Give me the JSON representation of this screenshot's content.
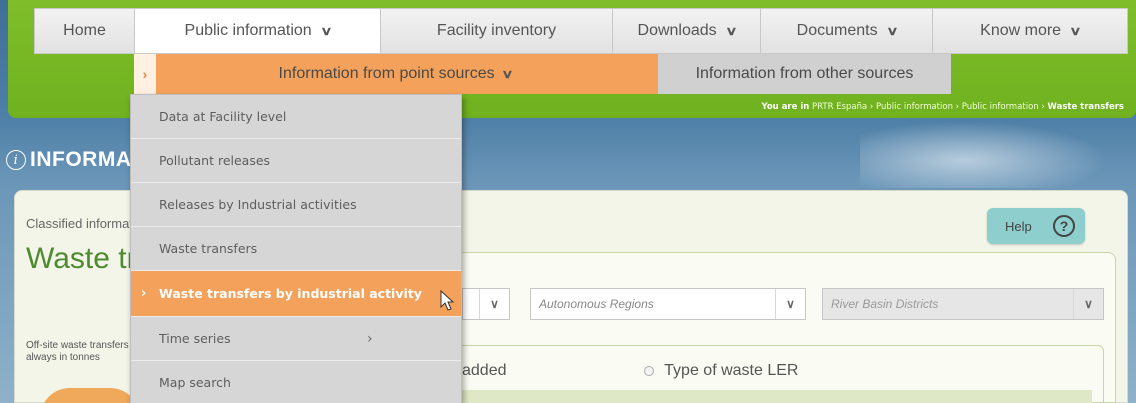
{
  "nav": {
    "items": [
      {
        "label": "Home",
        "has_menu": false
      },
      {
        "label": "Public information",
        "has_menu": true
      },
      {
        "label": "Facility inventory",
        "has_menu": false
      },
      {
        "label": "Downloads",
        "has_menu": true
      },
      {
        "label": "Documents",
        "has_menu": true
      },
      {
        "label": "Know more",
        "has_menu": true
      }
    ]
  },
  "subnav": {
    "point_sources": "Information from point sources",
    "other_sources": "Information from other sources"
  },
  "breadcrumb": {
    "you_are_in": "You are in",
    "items": [
      "PRTR España",
      "Public information",
      "Public information"
    ],
    "current": "Waste transfers"
  },
  "page": {
    "section_title": "INFORMATION",
    "classified_label": "Classified information",
    "title": "Waste transfers",
    "offsite_text": "Off-site waste transfers always in tonnes",
    "help_label": "Help",
    "filters": {
      "autonomous_regions_placeholder": "Autonomous Regions",
      "river_basin_placeholder": "River Basin Districts"
    },
    "radio_added": "added",
    "radio_ler": "Type of waste LER"
  },
  "dropdown": {
    "items": [
      {
        "label": "Data at Facility level",
        "active": false,
        "has_submenu": false
      },
      {
        "label": "Pollutant releases",
        "active": false,
        "has_submenu": false
      },
      {
        "label": "Releases by Industrial activities",
        "active": false,
        "has_submenu": false
      },
      {
        "label": "Waste transfers",
        "active": false,
        "has_submenu": false
      },
      {
        "label": "Waste transfers by industrial activity",
        "active": true,
        "has_submenu": false
      },
      {
        "label": "Time series",
        "active": false,
        "has_submenu": true
      },
      {
        "label": "Map search",
        "active": false,
        "has_submenu": false
      }
    ]
  },
  "colors": {
    "accent_orange": "#f4a25b",
    "brand_green": "#6fb11f",
    "title_green": "#4e8a30",
    "help_teal": "#8ecfcd"
  }
}
